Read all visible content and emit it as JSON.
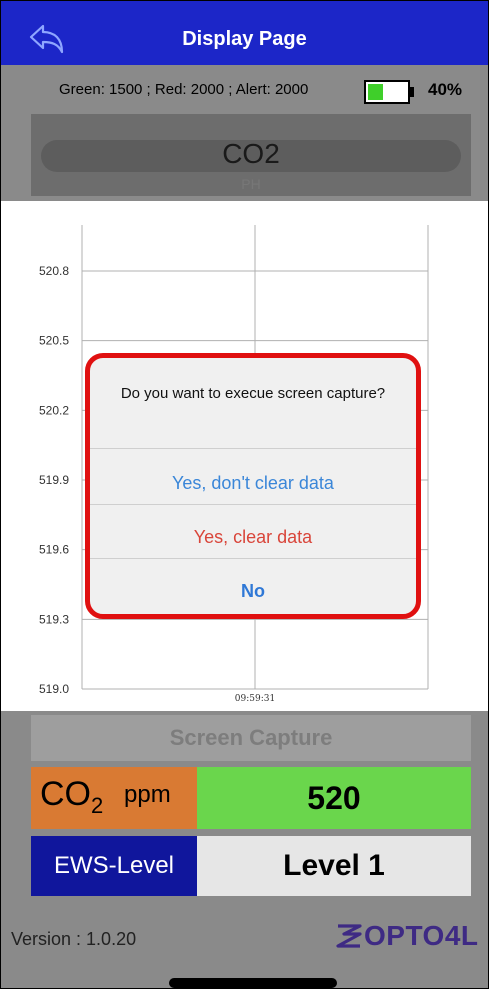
{
  "app": {
    "title": "Display Page"
  },
  "status": {
    "thresholds": "Green: 1500 ; Red: 2000 ; Alert: 2000",
    "battery_percent": "40%",
    "battery_level": 0.4
  },
  "header": {
    "title": "CO2",
    "subtitle": "PH"
  },
  "chart_data": {
    "type": "line",
    "y_ticks": [
      "520.8",
      "520.5",
      "520.2",
      "519.9",
      "519.6",
      "519.3",
      "519.0"
    ],
    "x_ticks": [
      "09:59:31"
    ],
    "ylim": [
      519.0,
      520.8
    ],
    "grid": true,
    "series": []
  },
  "dialog": {
    "message": "Do you want to execue screen capture?",
    "buttons": [
      {
        "label": "Yes, don't clear data",
        "color": "#3a86d8"
      },
      {
        "label": "Yes, clear data",
        "color": "#d9453a"
      },
      {
        "label": "No",
        "color": "#2f78d6"
      }
    ]
  },
  "capture_button": {
    "label": "Screen Capture"
  },
  "co2": {
    "label_main": "CO",
    "label_sub": "2",
    "unit": "ppm",
    "value": "520"
  },
  "ews": {
    "label": "EWS-Level",
    "value": "Level 1"
  },
  "footer": {
    "version": "Version : 1.0.20",
    "logo": "OPTO4L"
  },
  "colors": {
    "topbar": "#1c26c8",
    "co2_label_bg": "#d97a33",
    "co2_value_bg": "#6ad64c",
    "ews_label_bg": "#10169c",
    "dialog_border": "#e01010"
  }
}
